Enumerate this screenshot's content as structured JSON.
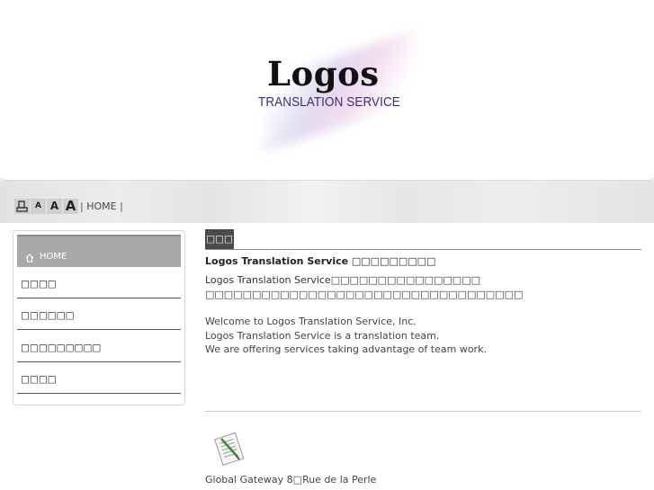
{
  "logo": {
    "name": "Logos",
    "tagline": "TRANSLATION SERVICE"
  },
  "toolbar": {
    "print_icon": "print-icon",
    "font_small": "A",
    "font_medium": "A",
    "font_large": "A",
    "breadcrumb_sep_start": "|",
    "breadcrumb_home": "HOME",
    "breadcrumb_sep_end": "|"
  },
  "sidebar": {
    "home_icon": "home-icon",
    "home_label": "HOME",
    "items": [
      {
        "label": "□□□□"
      },
      {
        "label": "□□□□□□"
      },
      {
        "label": "□□□□□□□□□"
      },
      {
        "label": "□□□□"
      }
    ]
  },
  "main": {
    "section_tab": "□□□",
    "heading": "Logos Translation Service □□□□□□□□□",
    "jp_line1": "Logos Translation Service□□□□□□□□□□□□□□□□",
    "jp_line2": "□□□□□□□□□□□□□□□□□□□□□□□□□□□□□□□□□□",
    "en_line1": "Welcome to Logos Translation Service, Inc.",
    "en_line2": "Logos Translation Service is a translation team.",
    "en_line3": "We are offering services taking advantage of team work.",
    "doc_icon": "document-pen-icon",
    "address_line1": "Global Gateway 8□Rue de la Perle"
  },
  "colors": {
    "tagline": "#3b2e74",
    "nav_active_bg": "#a9a9a9",
    "section_tab_bg": "#4a4a4a"
  }
}
